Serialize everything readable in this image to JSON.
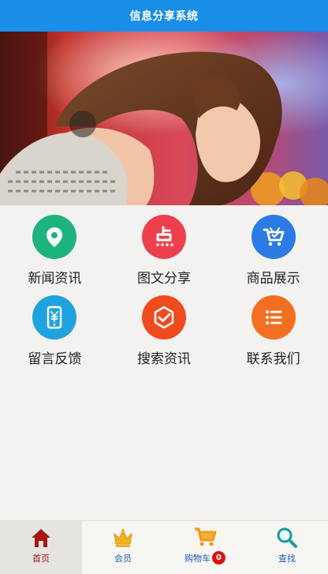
{
  "header": {
    "title": "信息分享系统"
  },
  "banner": {
    "image": "woman-smiling-photo"
  },
  "grid": {
    "items": [
      {
        "label": "新闻资讯",
        "icon": "location-pin-icon",
        "color": "#1db37d"
      },
      {
        "label": "图文分享",
        "icon": "dot-text-icon",
        "color": "#ee3f4d"
      },
      {
        "label": "商品展示",
        "icon": "shopping-cart-icon",
        "color": "#2c7be5"
      },
      {
        "label": "留言反馈",
        "icon": "phone-yen-icon",
        "color": "#1fa3e0"
      },
      {
        "label": "搜索资讯",
        "icon": "check-hexagon-icon",
        "color": "#f04a1e"
      },
      {
        "label": "联系我们",
        "icon": "list-icon",
        "color": "#f26f22"
      }
    ]
  },
  "tabbar": {
    "tabs": [
      {
        "label": "首页",
        "icon": "home-icon",
        "active": true
      },
      {
        "label": "会员",
        "icon": "crown-icon",
        "active": false
      },
      {
        "label": "购物车",
        "icon": "cart-icon",
        "active": false,
        "badge": "0"
      },
      {
        "label": "查找",
        "icon": "search-icon",
        "active": false
      }
    ]
  }
}
